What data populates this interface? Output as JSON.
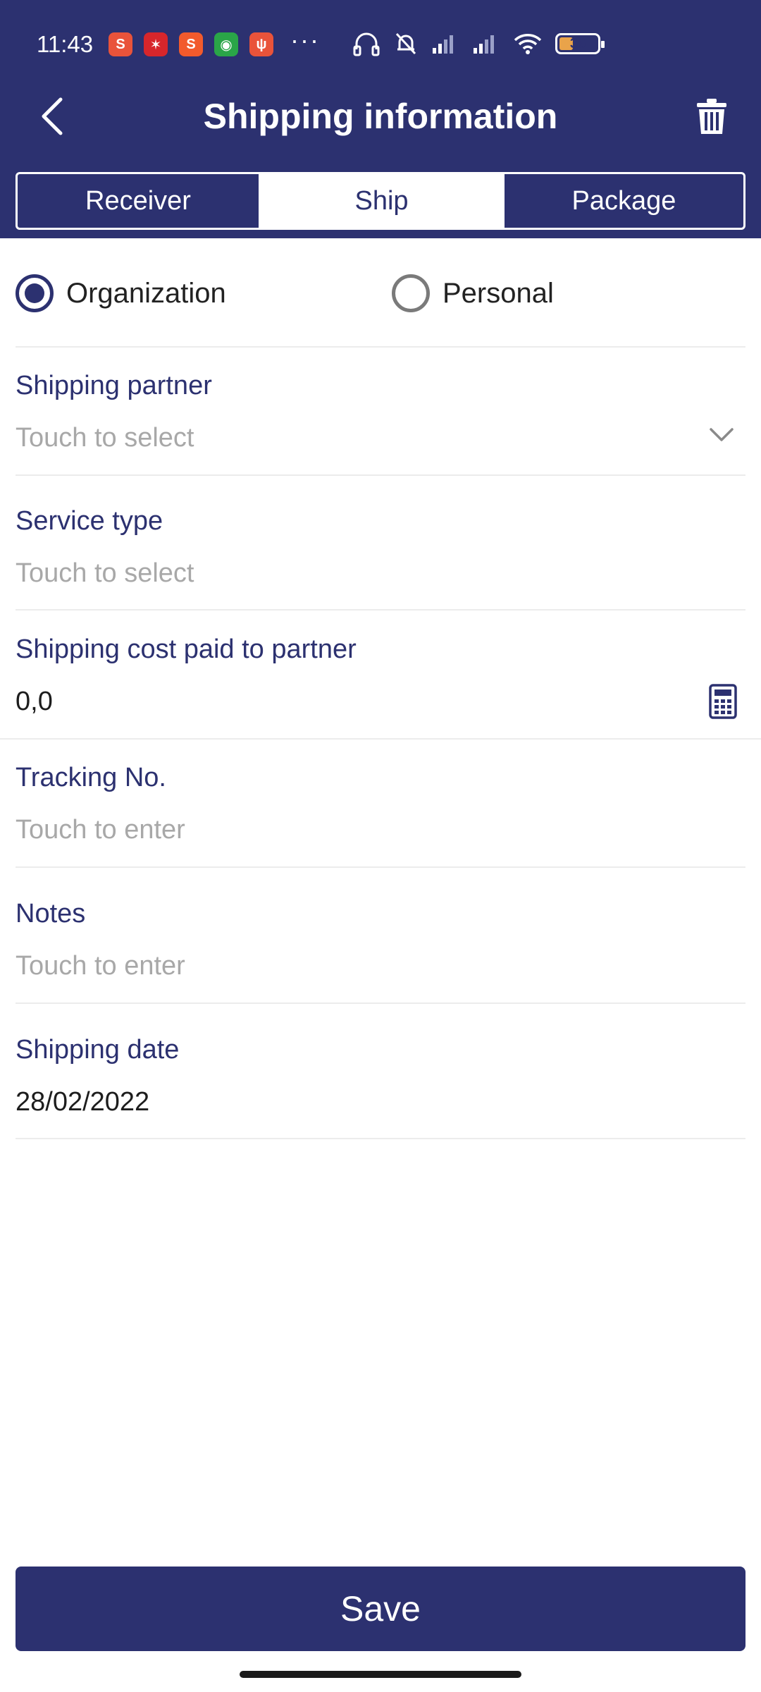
{
  "status_bar": {
    "time": "11:43",
    "more": "···",
    "battery_level": "36",
    "notification_icons": [
      {
        "name": "shopee-icon",
        "glyph": "S",
        "color": "#e9533a"
      },
      {
        "name": "game-app-icon",
        "glyph": "✶",
        "color": "#d7262b"
      },
      {
        "name": "shopee-mall-icon",
        "glyph": "S",
        "color": "#f25a2c"
      },
      {
        "name": "green-app-icon",
        "glyph": "◉",
        "color": "#2aa548"
      },
      {
        "name": "food-app-icon",
        "glyph": "ψ",
        "color": "#e9533a"
      }
    ]
  },
  "header": {
    "title": "Shipping information",
    "background_color": "#2c3170"
  },
  "tabs": [
    {
      "label": "Receiver",
      "selected": false
    },
    {
      "label": "Ship",
      "selected": true
    },
    {
      "label": "Package",
      "selected": false
    }
  ],
  "receiver_type": {
    "options": [
      {
        "label": "Organization",
        "checked": true
      },
      {
        "label": "Personal",
        "checked": false
      }
    ]
  },
  "form": {
    "shipping_partner": {
      "label": "Shipping partner",
      "placeholder": "Touch to select"
    },
    "service_type": {
      "label": "Service type",
      "placeholder": "Touch to select"
    },
    "shipping_cost": {
      "label": "Shipping cost paid to partner",
      "value": "0,0"
    },
    "tracking_no": {
      "label": "Tracking No.",
      "placeholder": "Touch to enter"
    },
    "notes": {
      "label": "Notes",
      "placeholder": "Touch to enter"
    },
    "shipping_date": {
      "label": "Shipping date",
      "value": "28/02/2022"
    }
  },
  "footer": {
    "save_label": "Save"
  }
}
